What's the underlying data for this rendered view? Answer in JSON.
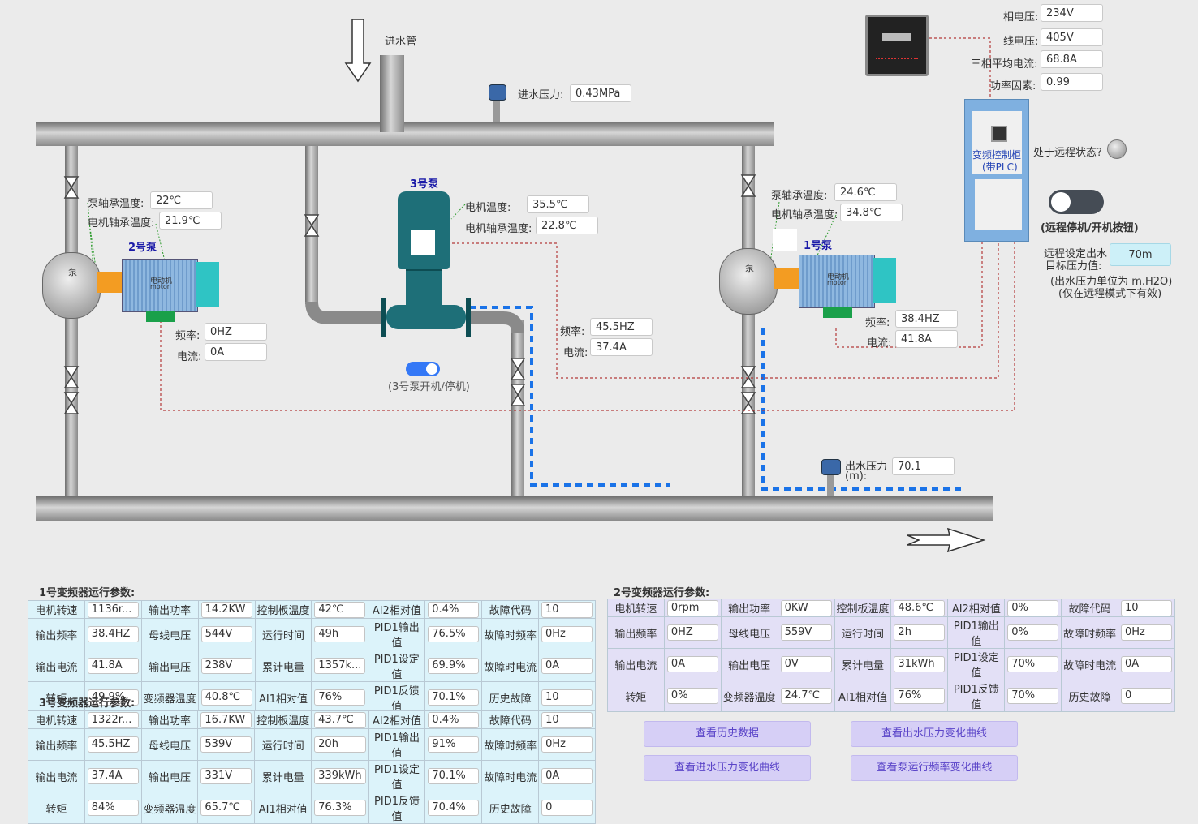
{
  "inlet": {
    "label": "进水管",
    "pressure_label": "进水压力:",
    "pressure_value": "0.43MPa"
  },
  "power_meter": {
    "phase_voltage_label": "相电压:",
    "phase_voltage": "234V",
    "line_voltage_label": "线电压:",
    "line_voltage": "405V",
    "avg_current_label": "三相平均电流:",
    "avg_current": "68.8A",
    "power_factor_label": "功率因素:",
    "power_factor": "0.99"
  },
  "cabinet": {
    "label_line1": "变频控制柜",
    "label_line2": "(带PLC)"
  },
  "remote": {
    "status_label": "处于远程状态?",
    "toggle_label": "(远程停机/开机按钮)",
    "target_label_line1": "远程设定出水",
    "target_label_line2": "目标压力值:",
    "target_value": "70m",
    "note_line1": "(出水压力单位为 m.H2O)",
    "note_line2": "(仅在远程模式下有效)"
  },
  "pump2": {
    "title": "2号泵",
    "pump_bearing_label": "泵轴承温度:",
    "pump_bearing": "22℃",
    "motor_bearing_label": "电机轴承温度:",
    "motor_bearing": "21.9℃",
    "freq_label": "频率:",
    "freq": "0HZ",
    "current_label": "电流:",
    "current": "0A"
  },
  "pump3": {
    "title": "3号泵",
    "motor_temp_label": "电机温度:",
    "motor_temp": "35.5℃",
    "motor_bearing_label": "电机轴承温度:",
    "motor_bearing": "22.8℃",
    "freq_label": "频率:",
    "freq": "45.5HZ",
    "current_label": "电流:",
    "current": "37.4A",
    "toggle_label": "(3号泵开机/停机)"
  },
  "pump1": {
    "title": "1号泵",
    "pump_bearing_label": "泵轴承温度:",
    "pump_bearing": "24.6℃",
    "motor_bearing_label": "电机轴承温度:",
    "motor_bearing": "34.8℃",
    "freq_label": "频率:",
    "freq": "38.4HZ",
    "current_label": "电流:",
    "current": "41.8A"
  },
  "motor_label": "电动机",
  "motor_label_en": "motor",
  "pump_body_char": "泵",
  "outlet": {
    "pressure_label_line1": "出水压力",
    "pressure_label_line2": "(m):",
    "pressure_value": "70.1"
  },
  "vfd1": {
    "title": "1号变频器运行参数:",
    "rows": [
      [
        "电机转速",
        "1136r...",
        "输出功率",
        "14.2KW",
        "控制板温度",
        "42℃",
        "AI2相对值",
        "0.4%",
        "故障代码",
        "10"
      ],
      [
        "输出频率",
        "38.4HZ",
        "母线电压",
        "544V",
        "运行时间",
        "49h",
        "PID1输出值",
        "76.5%",
        "故障时频率",
        "0Hz"
      ],
      [
        "输出电流",
        "41.8A",
        "输出电压",
        "238V",
        "累计电量",
        "1357k...",
        "PID1设定值",
        "69.9%",
        "故障时电流",
        "0A"
      ],
      [
        "转矩",
        "49.9%",
        "变频器温度",
        "40.8℃",
        "AI1相对值",
        "76%",
        "PID1反馈值",
        "70.1%",
        "历史故障",
        "10"
      ]
    ]
  },
  "vfd2": {
    "title": "2号变频器运行参数:",
    "rows": [
      [
        "电机转速",
        "0rpm",
        "输出功率",
        "0KW",
        "控制板温度",
        "48.6℃",
        "AI2相对值",
        "0%",
        "故障代码",
        "10"
      ],
      [
        "输出频率",
        "0HZ",
        "母线电压",
        "559V",
        "运行时间",
        "2h",
        "PID1输出值",
        "0%",
        "故障时频率",
        "0Hz"
      ],
      [
        "输出电流",
        "0A",
        "输出电压",
        "0V",
        "累计电量",
        "31kWh",
        "PID1设定值",
        "70%",
        "故障时电流",
        "0A"
      ],
      [
        "转矩",
        "0%",
        "变频器温度",
        "24.7℃",
        "AI1相对值",
        "76%",
        "PID1反馈值",
        "70%",
        "历史故障",
        "0"
      ]
    ]
  },
  "vfd3": {
    "title": "3号变频器运行参数:",
    "rows": [
      [
        "电机转速",
        "1322r...",
        "输出功率",
        "16.7KW",
        "控制板温度",
        "43.7℃",
        "AI2相对值",
        "0.4%",
        "故障代码",
        "10"
      ],
      [
        "输出频率",
        "45.5HZ",
        "母线电压",
        "539V",
        "运行时间",
        "20h",
        "PID1输出值",
        "91%",
        "故障时频率",
        "0Hz"
      ],
      [
        "输出电流",
        "37.4A",
        "输出电压",
        "331V",
        "累计电量",
        "339kWh",
        "PID1设定值",
        "70.1%",
        "故障时电流",
        "0A"
      ],
      [
        "转矩",
        "84%",
        "变频器温度",
        "65.7℃",
        "AI1相对值",
        "76.3%",
        "PID1反馈值",
        "70.4%",
        "历史故障",
        "0"
      ]
    ]
  },
  "buttons": {
    "history": "查看历史数据",
    "outlet_curve": "查看出水压力变化曲线",
    "inlet_curve": "查看进水压力变化曲线",
    "freq_curve": "查看泵运行频率变化曲线"
  },
  "colors": {
    "flow": "#1a73e8",
    "signal": "#b33a3a",
    "pump3": "#1e6f78",
    "motor": "#8fb8e0",
    "cabinet": "#7fb0e0",
    "table_blue": "#dcf3fa",
    "table_purple": "#e3e0f6",
    "button": "#d6cff6"
  }
}
